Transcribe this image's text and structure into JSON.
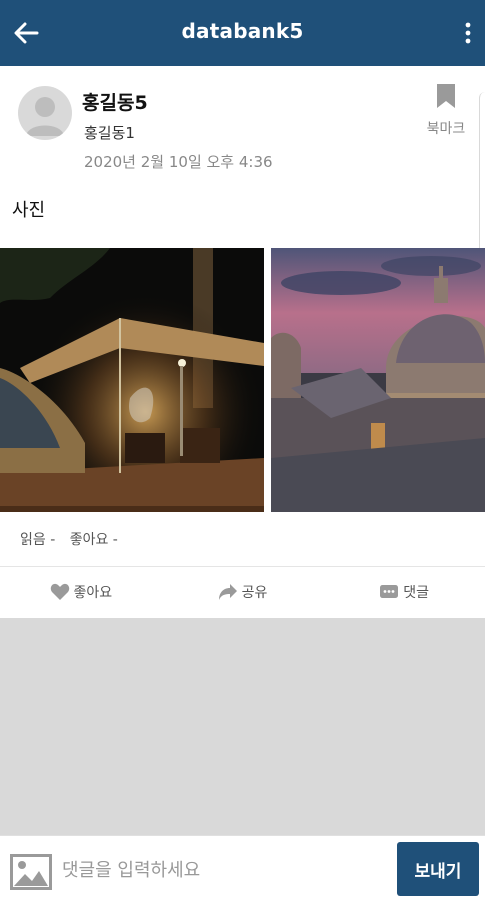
{
  "appbar": {
    "title": "databank5",
    "back_icon": "arrow-left-icon",
    "more_icon": "more-vertical-icon"
  },
  "post": {
    "author": "홍길동5",
    "sub_author": "홍길동1",
    "date": "2020년 2월 10일 오후 4:36",
    "bookmark_label": "북마크",
    "text": "사진",
    "photos": [
      {
        "name": "camping-tent-night-photo"
      },
      {
        "name": "domed-cathedral-dusk-photo"
      }
    ],
    "stats": {
      "reads": "읽음 -",
      "likes": "좋아요 -"
    }
  },
  "actions": {
    "like": "좋아요",
    "share": "공유",
    "comment": "댓글"
  },
  "comment_bar": {
    "placeholder": "댓글을 입력하세요",
    "value": "",
    "send_label": "보내기"
  },
  "colors": {
    "primary": "#1f5079",
    "content_background": "#d9d9d9",
    "icon_grey": "#9a9a9a"
  }
}
